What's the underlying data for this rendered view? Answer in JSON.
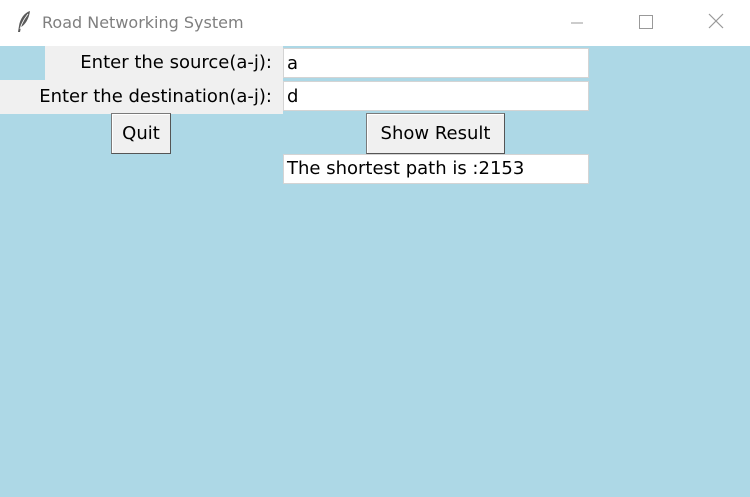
{
  "window": {
    "title": "Road Networking System",
    "icon": "feather-icon",
    "controls": [
      "minimize-icon",
      "maximize-icon",
      "close-icon"
    ]
  },
  "form": {
    "source_label": "Enter the source(a-j):",
    "source_value": "a",
    "destination_label": "Enter the destination(a-j):",
    "destination_value": "d",
    "quit_label": "Quit",
    "show_result_label": "Show Result",
    "result_text": "The shortest path is :2153"
  },
  "colors": {
    "background": "#add8e6",
    "label_bg": "#f0f0f0",
    "entry_bg": "#ffffff"
  }
}
